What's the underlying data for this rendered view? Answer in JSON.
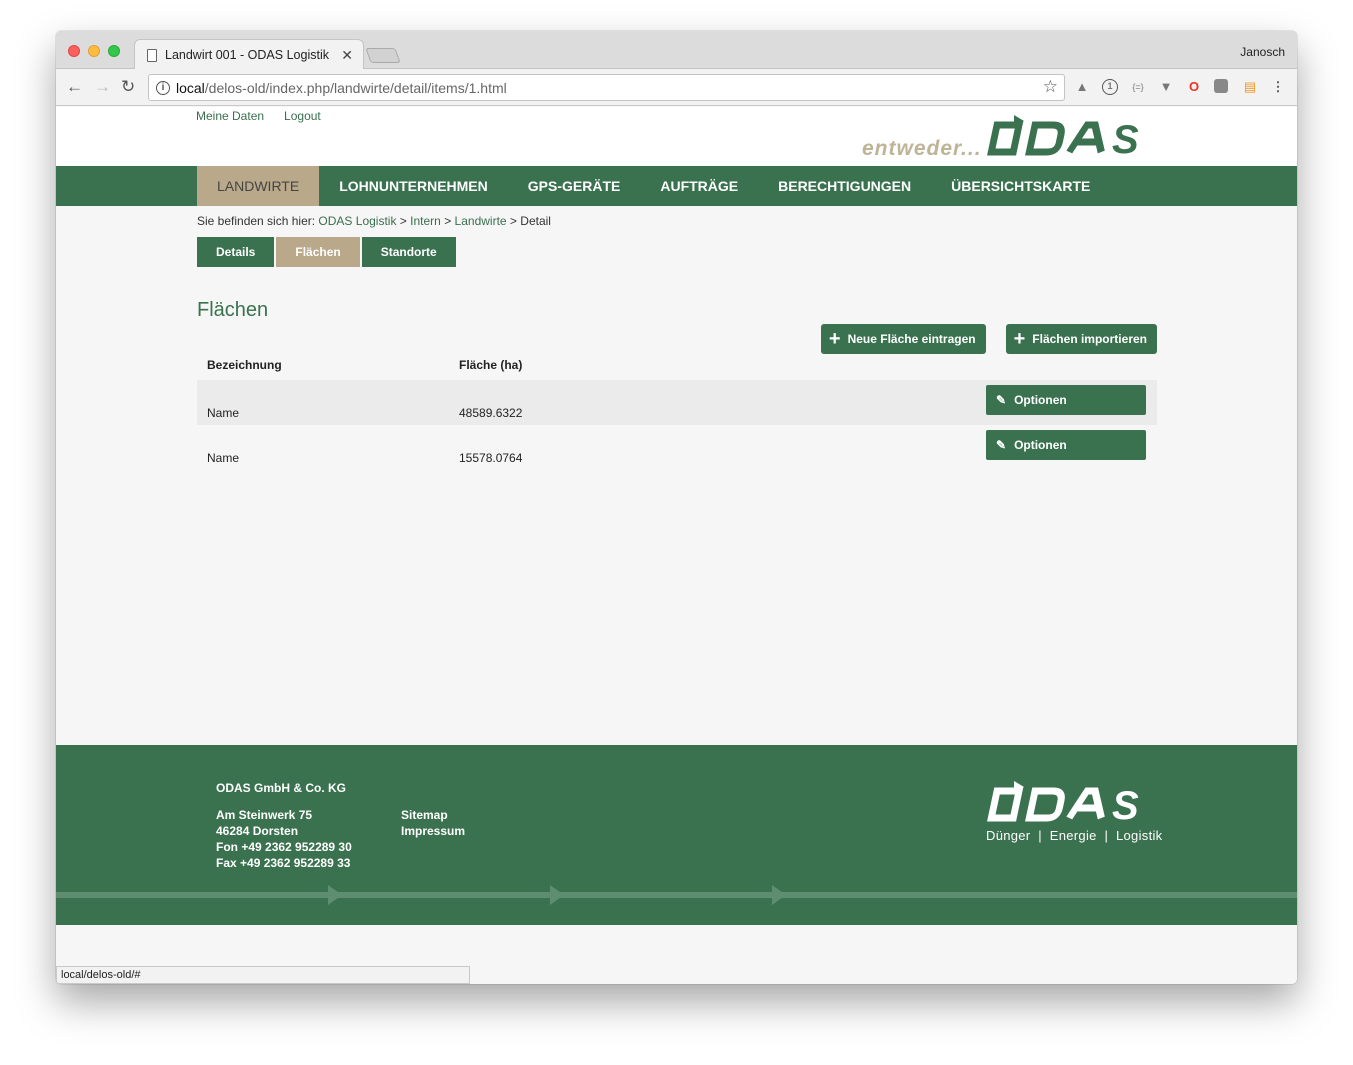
{
  "browser": {
    "tab_title": "Landwirt 001 - ODAS Logistik",
    "user": "Janosch",
    "url_host": "local",
    "url_path": "/delos-old/index.php/landwirte/detail/items/1.html",
    "status_url": "local/delos-old/#"
  },
  "header": {
    "links": [
      "Meine Daten",
      "Logout"
    ],
    "logo_slogan": "entweder...",
    "logo_text": "ODAS"
  },
  "nav": {
    "items": [
      "LANDWIRTE",
      "LOHNUNTERNEHMEN",
      "GPS-GERÄTE",
      "AUFTRÄGE",
      "BERECHTIGUNGEN",
      "ÜBERSICHTSKARTE"
    ],
    "active": "LANDWIRTE"
  },
  "breadcrumb": {
    "prefix": "Sie befinden sich hier:",
    "items": [
      "ODAS Logistik",
      "Intern",
      "Landwirte"
    ],
    "current": "Detail",
    "separator": ">"
  },
  "subtabs": {
    "items": [
      "Details",
      "Flächen",
      "Standorte"
    ],
    "active": "Flächen"
  },
  "main": {
    "title": "Flächen",
    "buttons": {
      "new": "Neue Fläche eintragen",
      "import": "Flächen importieren"
    },
    "columns": [
      "Bezeichnung",
      "Fläche (ha)"
    ],
    "rows": [
      {
        "name": "Name",
        "area": "48589.6322",
        "option": "Optionen"
      },
      {
        "name": "Name",
        "area": "15578.0764",
        "option": "Optionen"
      }
    ]
  },
  "footer": {
    "company": "ODAS GmbH & Co. KG",
    "address": [
      "Am Steinwerk 75",
      "46284 Dorsten",
      "Fon +49 2362 952289 30",
      "Fax +49 2362 952289 33"
    ],
    "links": [
      "Sitemap",
      "Impressum"
    ],
    "logo_text": "ODAS",
    "tagline": "Dünger  |  Energie  |  Logistik"
  },
  "colors": {
    "brand_green": "#3a7250",
    "brand_beige": "#b9a889"
  }
}
